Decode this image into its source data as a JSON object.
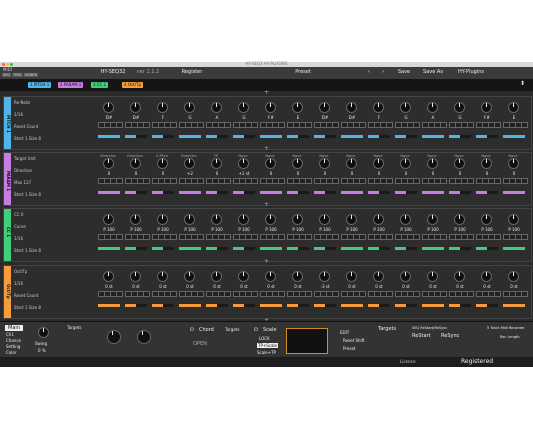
{
  "window": {
    "title": "HY-SEQ3 HY-PLUGINS"
  },
  "header": {
    "midi_label": "MIDI",
    "mode_buttons": [
      "SEQ",
      "TRIG",
      "ORDER"
    ],
    "plugin_name": "HY-SEQ32",
    "version": "ver 1.1.2",
    "register": "Register",
    "preset_label": "Preset",
    "save": "Save",
    "save_as": "Save As",
    "brand": "HY-Plugins"
  },
  "tabs": [
    {
      "num": "1",
      "label": "PITCH 1",
      "color": "#4fb4e8"
    },
    {
      "num": "2",
      "label": "PARAM 1",
      "color": "#c77ce0"
    },
    {
      "num": "3",
      "label": "CC 1",
      "color": "#3fcf7a"
    },
    {
      "num": "4",
      "label": "Oct/Tp",
      "color": "#f59c3c"
    }
  ],
  "rows": [
    {
      "side": "PITCH 1",
      "color": "#4fb4e8",
      "controls": [
        "Re-Note",
        "1/16",
        "Reset Count",
        "Start 1  Size 8"
      ],
      "labels": [
        "D#",
        "D#",
        "F",
        "G",
        "A",
        "G",
        "F#",
        "E",
        "D#",
        "D#",
        "F",
        "G",
        "A",
        "G",
        "F#",
        "E"
      ],
      "bar_color": "#4fb4e8"
    },
    {
      "side": "PARAM 1",
      "color": "#c77ce0",
      "controls": [
        "Target Unit",
        "Direction",
        "Max 127",
        "Start 1  Size 8"
      ],
      "heads": [
        "Direction",
        "Direction",
        "S-Pitch",
        "Direction",
        "TP",
        "None",
        "None",
        "None",
        "None",
        "None",
        "None",
        "None",
        "None",
        "None",
        "None",
        "None"
      ],
      "labels": [
        "0",
        "0",
        "0",
        "+2",
        "0",
        "+1 st",
        "0",
        "0",
        "0",
        "0",
        "0",
        "0",
        "0",
        "0",
        "0",
        "0"
      ],
      "bar_color": "#c77ce0"
    },
    {
      "side": "CC 1",
      "color": "#3fcf7a",
      "controls": [
        "CC 0",
        "Curve",
        "1/16",
        "Start 1  Size 8"
      ],
      "labels": [
        "P 100",
        "P 100",
        "P 100",
        "P 100",
        "P 100",
        "P 100",
        "P 100",
        "P 100",
        "P 100",
        "P 100",
        "P 100",
        "P 100",
        "P 100",
        "P 100",
        "P 100",
        "P 100"
      ],
      "bar_color": "#3fcf7a"
    },
    {
      "side": "Oct/Tp",
      "color": "#f59c3c",
      "controls": [
        "Oct/Tp",
        "1/16",
        "Reset Count",
        "Start 1  Size 8"
      ],
      "labels": [
        "0 st",
        "0 st",
        "0 st",
        "0 st",
        "0 st",
        "0 st",
        "0 st",
        "0 st",
        "-3 st",
        "0 st",
        "0 st",
        "0 st",
        "0 st",
        "0 st",
        "0 st",
        "0 st"
      ],
      "bar_color": "#f59c3c"
    }
  ],
  "footer": {
    "main": "Main",
    "side_items": [
      "Ch1",
      "Chance",
      "Setting",
      "Color"
    ],
    "swing": "Swing",
    "swing_value": "0 %",
    "targets1": "Targets",
    "chord": "Chord",
    "open": "OPEN",
    "targets2": "Targets",
    "scale": "Scale",
    "lock": "LOCK",
    "tp_scale": "TP+Scale",
    "scale_tp": "Scale+TP",
    "edit": "EDIT",
    "reset_shift": "Reset Shift",
    "preset": "Preset",
    "targets3": "Targets",
    "restart_title": "SEQ ReStart/ReSync",
    "restart": "ReStart",
    "resync": "ReSync",
    "recorder": "5 Track Midi Recorder",
    "rec_length": "Rec Length"
  },
  "status": {
    "license": "License:",
    "registered": "Registered"
  }
}
